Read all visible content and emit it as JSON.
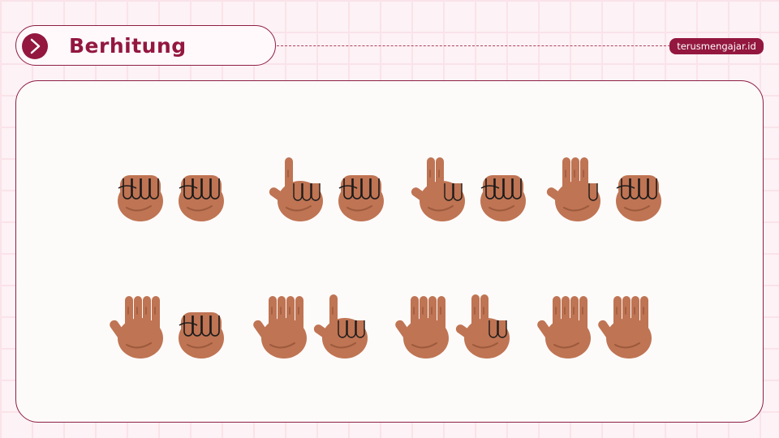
{
  "header": {
    "title": "Berhitung",
    "arrow_icon": "chevron-right-icon",
    "brand": "terusmengajar.id"
  },
  "colors": {
    "accent": "#93173f",
    "skin": "#bf7453",
    "skin_shadow": "#9c5a3d",
    "background": "#fdf2f5",
    "card": "#fdfbfa"
  },
  "finger_counts": [
    {
      "count": 0,
      "left_hand": "fist",
      "right_hand": "fist"
    },
    {
      "count": 1,
      "left_hand": "one-finger",
      "right_hand": "fist"
    },
    {
      "count": 2,
      "left_hand": "two-fingers",
      "right_hand": "fist"
    },
    {
      "count": 3,
      "left_hand": "three-fingers",
      "right_hand": "fist"
    },
    {
      "count": 5,
      "left_hand": "open-hand",
      "right_hand": "fist"
    },
    {
      "count": 6,
      "left_hand": "open-hand",
      "right_hand": "one-finger"
    },
    {
      "count": 7,
      "left_hand": "open-hand",
      "right_hand": "two-fingers"
    },
    {
      "count": 10,
      "left_hand": "open-hand",
      "right_hand": "open-hand"
    }
  ]
}
